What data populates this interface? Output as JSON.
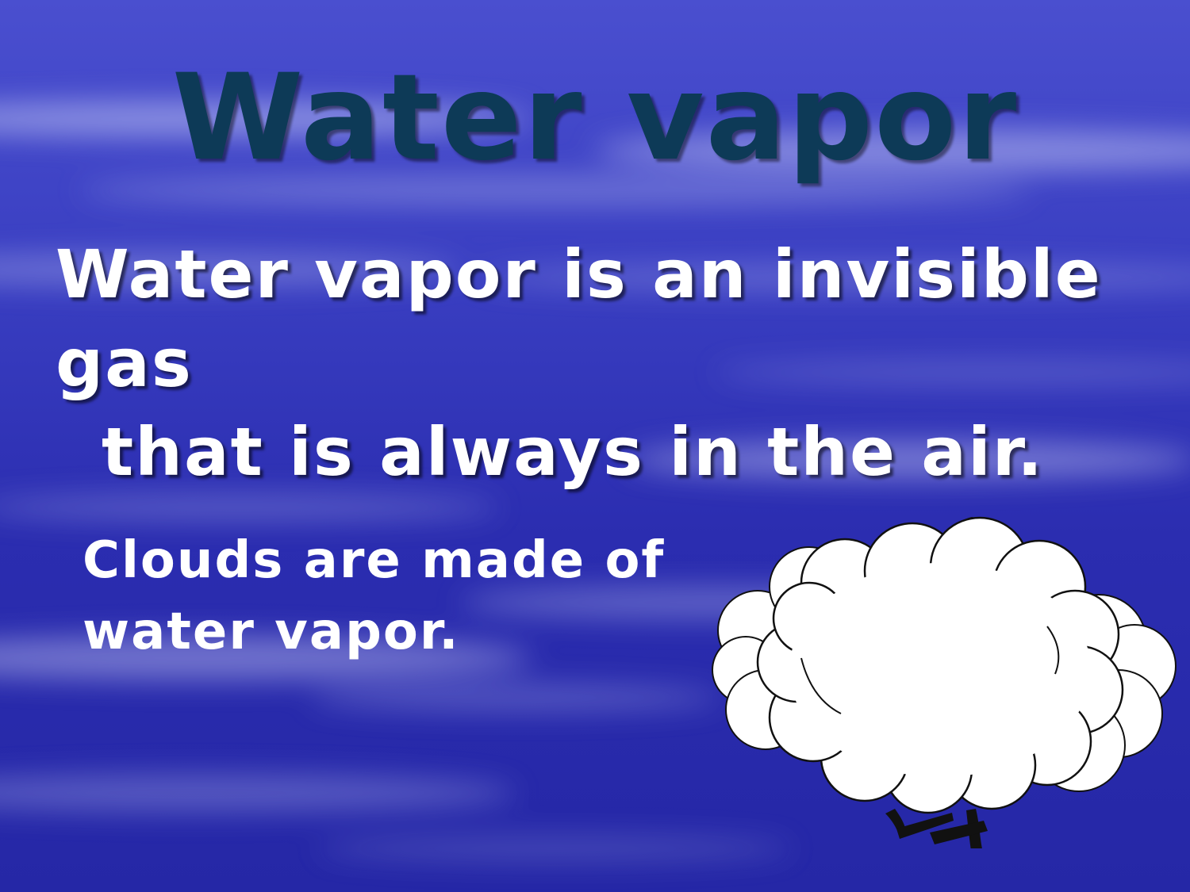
{
  "slide": {
    "title": "Water vapor",
    "body_line1": "Water vapor is an invisible gas",
    "body_line2": "that is always in the air.",
    "caption_line1": "Clouds are made of",
    "caption_line2": "water vapor."
  },
  "illustration": {
    "icon": "cloud-character-icon"
  },
  "colors": {
    "background": "#3a3fc2",
    "title": "#0d3a57",
    "text": "#ffffff"
  }
}
